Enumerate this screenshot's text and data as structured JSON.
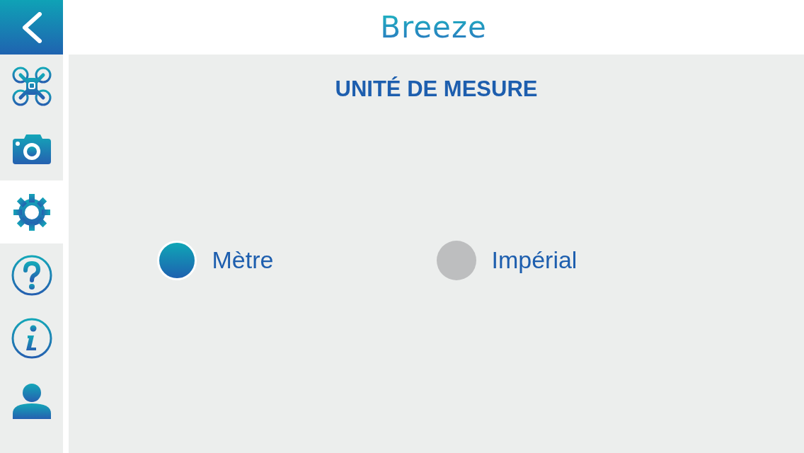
{
  "header": {
    "logo": "Breeze"
  },
  "sidebar": {
    "items": [
      {
        "kind": "drone",
        "selected": false
      },
      {
        "kind": "camera",
        "selected": false
      },
      {
        "kind": "settings",
        "selected": true
      },
      {
        "kind": "help",
        "selected": false
      },
      {
        "kind": "info",
        "selected": false
      },
      {
        "kind": "user",
        "selected": false
      }
    ]
  },
  "section": {
    "title": "UNITÉ DE MESURE"
  },
  "options": [
    {
      "label": "Mètre",
      "selected": true
    },
    {
      "label": "Impérial",
      "selected": false
    }
  ]
}
